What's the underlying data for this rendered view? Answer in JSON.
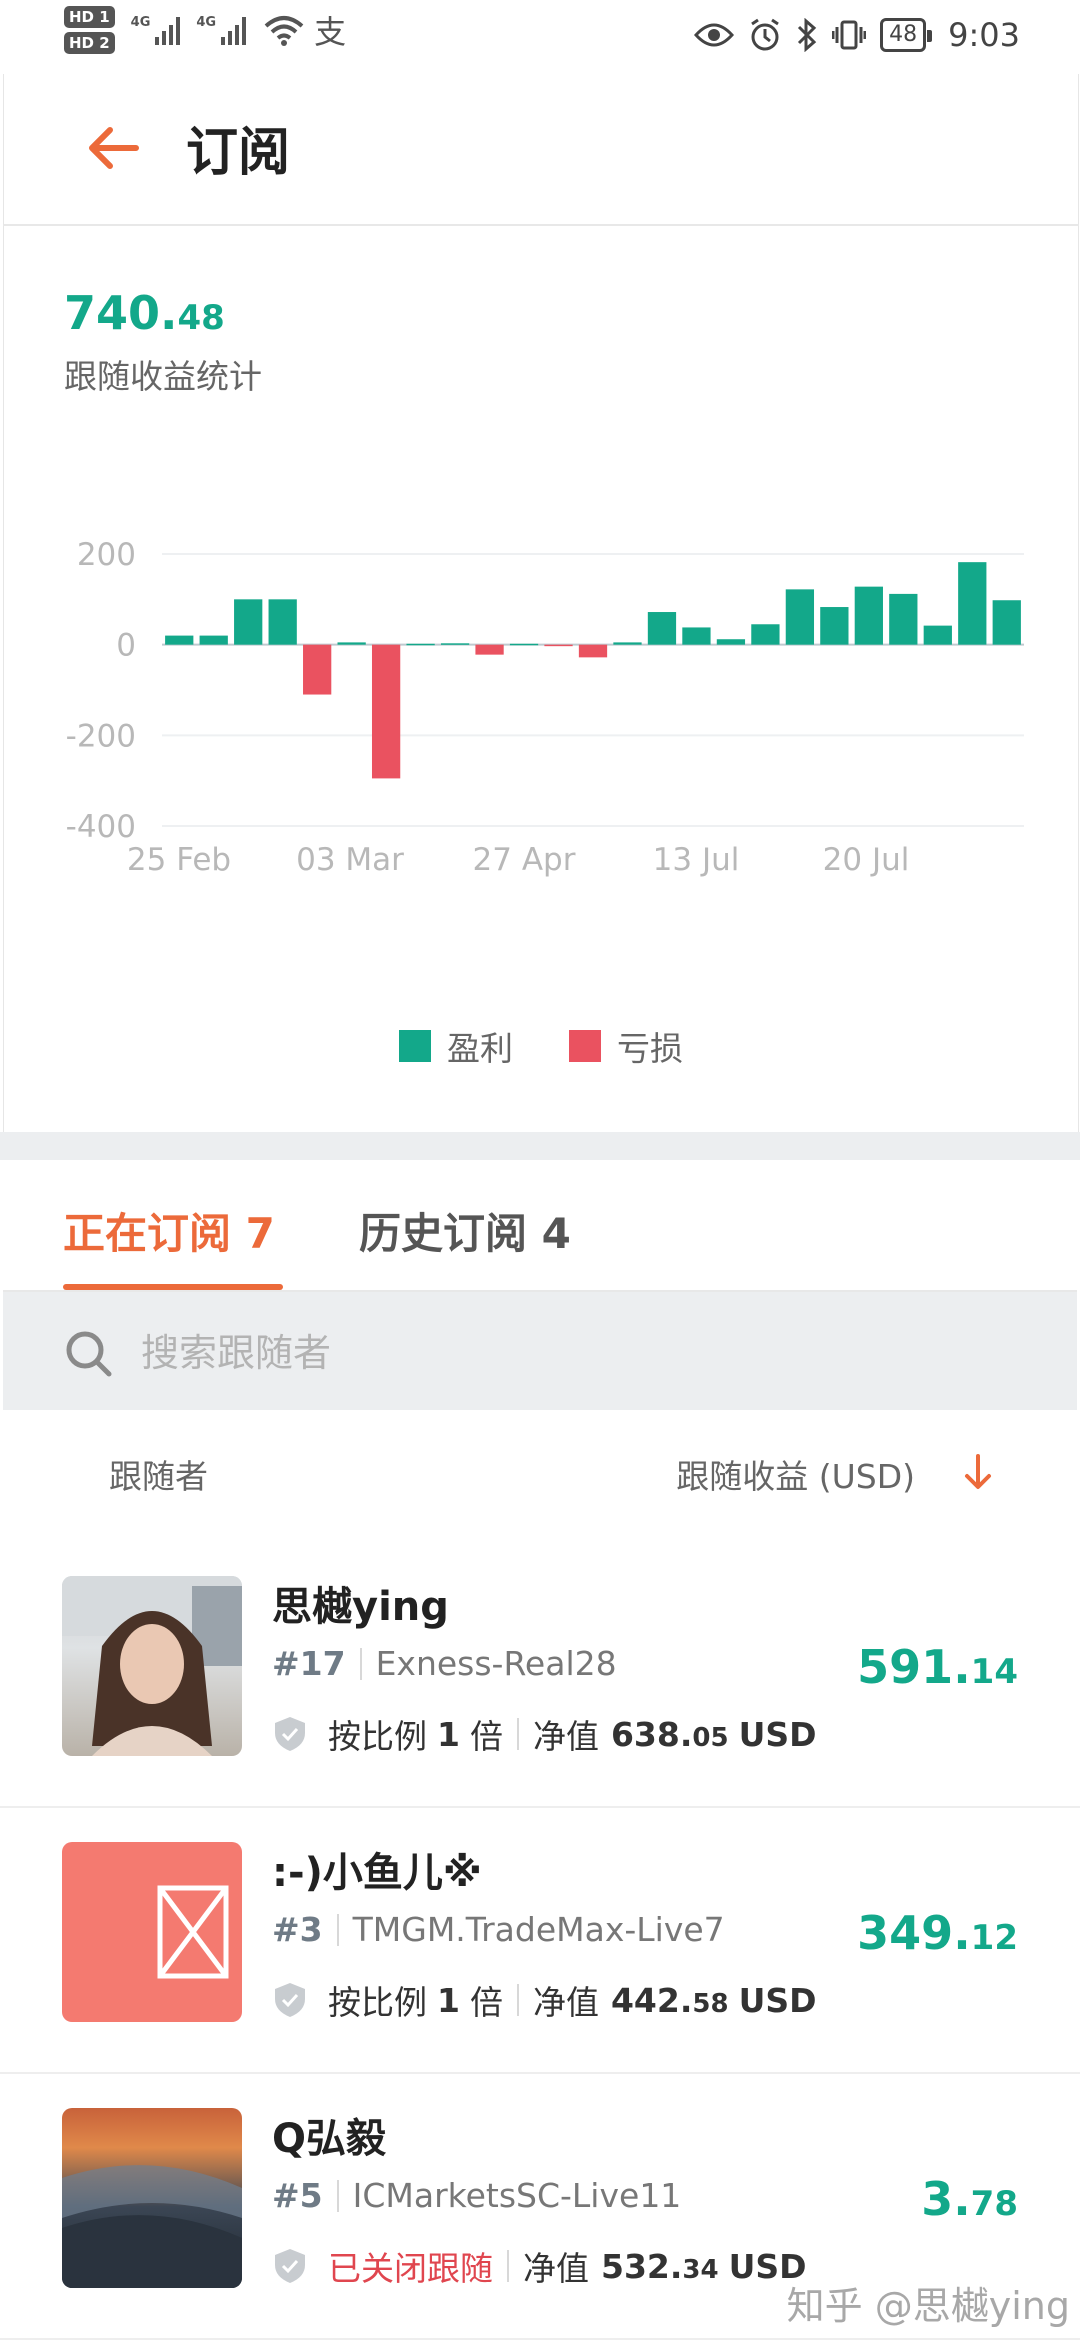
{
  "status_bar": {
    "hd1": "HD 1",
    "hd2": "HD 2",
    "net1": "4G",
    "net2": "4G",
    "alipay_glyph": "支",
    "battery": "48",
    "time": "9:03",
    "icons": [
      "eye-icon",
      "alarm-icon",
      "bluetooth-icon",
      "vibrate-icon",
      "battery-icon"
    ]
  },
  "header": {
    "title": "订阅",
    "back_icon": "arrow-left-icon"
  },
  "stats": {
    "value_int": "740.",
    "value_dec": "48",
    "label": "跟随收益统计"
  },
  "chart_data": {
    "type": "bar",
    "ylim": [
      -400,
      200
    ],
    "yticks": [
      200,
      0,
      -200,
      -400
    ],
    "y_tick_labels": [
      "200",
      "0",
      "-200",
      "-400"
    ],
    "x_tick_labels": [
      "25 Feb",
      "03 Mar",
      "27 Apr",
      "13 Jul",
      "20 Jul"
    ],
    "grid": true,
    "legend_position": "bottom",
    "values": [
      20,
      20,
      100,
      100,
      -110,
      5,
      -295,
      2,
      3,
      -22,
      2,
      -2,
      -28,
      5,
      72,
      38,
      12,
      45,
      122,
      83,
      128,
      112,
      42,
      182,
      98
    ],
    "series": [
      {
        "name": "盈利",
        "color": "#13a88a"
      },
      {
        "name": "亏损",
        "color": "#ea5260"
      }
    ]
  },
  "tabs": [
    {
      "label": "正在订阅 7",
      "active": true
    },
    {
      "label": "历史订阅 4",
      "active": false
    }
  ],
  "search": {
    "placeholder": "搜索跟随者"
  },
  "columns": {
    "left": "跟随者",
    "right": "跟随收益 (USD)"
  },
  "rows": [
    {
      "name": "思樾ying",
      "rank": "#17",
      "server": "Exness-Real28",
      "mode_prefix": "按比例",
      "mode_num": "1",
      "mode_suffix": "倍",
      "nav_label": "净值",
      "nav_int": "638.",
      "nav_dec": "05",
      "currency": "USD",
      "earn_int": "591.",
      "earn_dec": "14"
    },
    {
      "name": ":-)小鱼儿※",
      "rank": "#3",
      "server": "TMGM.TradeMax-Live7",
      "mode_prefix": "按比例",
      "mode_num": "1",
      "mode_suffix": "倍",
      "nav_label": "净值",
      "nav_int": "442.",
      "nav_dec": "58",
      "currency": "USD",
      "earn_int": "349.",
      "earn_dec": "12"
    },
    {
      "name": "Q弘毅",
      "rank": "#5",
      "server": "ICMarketsSC-Live11",
      "status": "已关闭跟随",
      "nav_label": "净值",
      "nav_int": "532.",
      "nav_dec": "34",
      "currency": "USD",
      "earn_int": "3.",
      "earn_dec": "78"
    }
  ],
  "watermark": "知乎 @思樾ying",
  "colors": {
    "accent": "#ec6a3a",
    "profit": "#13a88a",
    "loss": "#ea5260"
  }
}
